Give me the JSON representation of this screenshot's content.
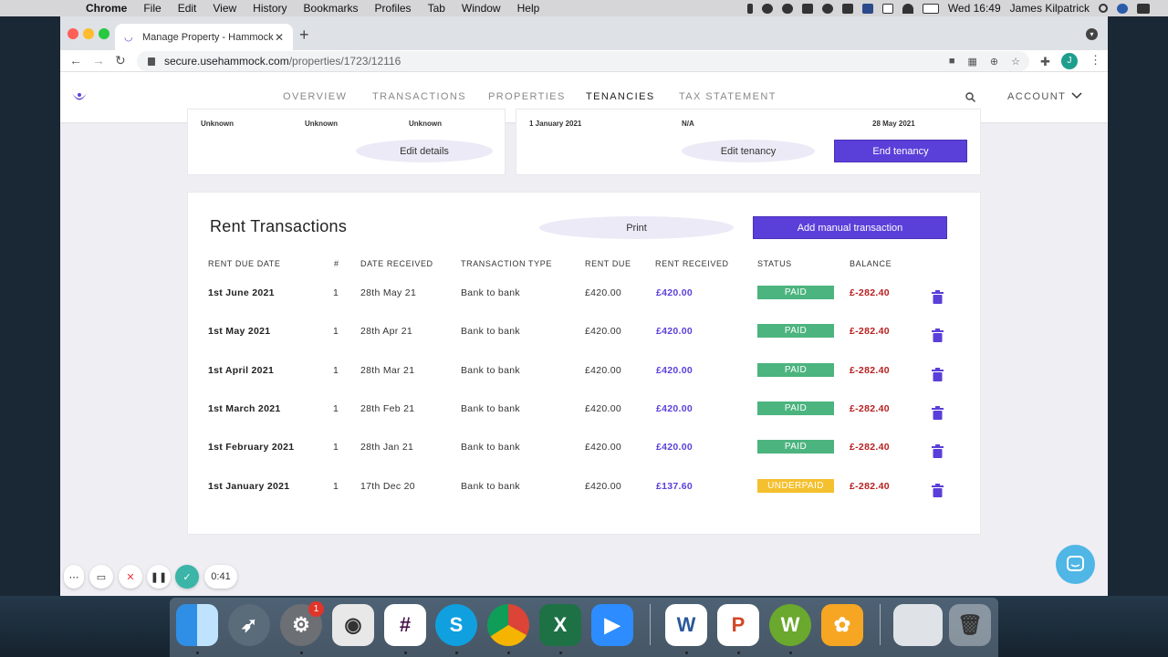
{
  "menubar": {
    "app_name": "Chrome",
    "menus": [
      "File",
      "Edit",
      "View",
      "History",
      "Bookmarks",
      "Profiles",
      "Tab",
      "Window",
      "Help"
    ],
    "clock": "Wed 16:49",
    "user": "James Kilpatrick"
  },
  "browser": {
    "tab_title": "Manage Property - Hammock",
    "url_host": "secure.usehammock.com",
    "url_path": "/properties/1723/12116",
    "profile_initial": "J"
  },
  "nav": {
    "links": [
      "OVERVIEW",
      "TRANSACTIONS",
      "PROPERTIES",
      "TENANCIES",
      "TAX STATEMENT"
    ],
    "active": "TENANCIES",
    "account": "ACCOUNT"
  },
  "top_cards": {
    "left": {
      "values": [
        "Unknown",
        "Unknown",
        "Unknown"
      ],
      "button": "Edit details"
    },
    "right": {
      "values": [
        "1 January 2021",
        "N/A",
        "28 May 2021"
      ],
      "edit_button": "Edit tenancy",
      "end_button": "End tenancy"
    }
  },
  "rent": {
    "title": "Rent Transactions",
    "print_button": "Print",
    "add_button": "Add manual transaction",
    "headers": [
      "RENT DUE DATE",
      "#",
      "DATE RECEIVED",
      "TRANSACTION TYPE",
      "RENT DUE",
      "RENT RECEIVED",
      "STATUS",
      "BALANCE"
    ],
    "rows": [
      {
        "due_date": "1st June 2021",
        "num": "1",
        "received_date": "28th May 21",
        "type": "Bank to bank",
        "rent_due": "£420.00",
        "rent_received": "£420.00",
        "status": "PAID",
        "balance": "£-282.40"
      },
      {
        "due_date": "1st May 2021",
        "num": "1",
        "received_date": "28th Apr 21",
        "type": "Bank to bank",
        "rent_due": "£420.00",
        "rent_received": "£420.00",
        "status": "PAID",
        "balance": "£-282.40"
      },
      {
        "due_date": "1st April 2021",
        "num": "1",
        "received_date": "28th Mar 21",
        "type": "Bank to bank",
        "rent_due": "£420.00",
        "rent_received": "£420.00",
        "status": "PAID",
        "balance": "£-282.40"
      },
      {
        "due_date": "1st March 2021",
        "num": "1",
        "received_date": "28th Feb 21",
        "type": "Bank to bank",
        "rent_due": "£420.00",
        "rent_received": "£420.00",
        "status": "PAID",
        "balance": "£-282.40"
      },
      {
        "due_date": "1st February 2021",
        "num": "1",
        "received_date": "28th Jan 21",
        "type": "Bank to bank",
        "rent_due": "£420.00",
        "rent_received": "£420.00",
        "status": "PAID",
        "balance": "£-282.40"
      },
      {
        "due_date": "1st January 2021",
        "num": "1",
        "received_date": "17th Dec 20",
        "type": "Bank to bank",
        "rent_due": "£420.00",
        "rent_received": "£137.60",
        "status": "UNDERPAID",
        "balance": "£-282.40"
      }
    ]
  },
  "recorder": {
    "time": "0:41"
  },
  "dock": {
    "notification_badge": "1"
  },
  "colors": {
    "accent": "#5b3fd9",
    "paid": "#4cb47f",
    "underpaid": "#f5c02f",
    "balance_negative": "#b81e1e"
  }
}
